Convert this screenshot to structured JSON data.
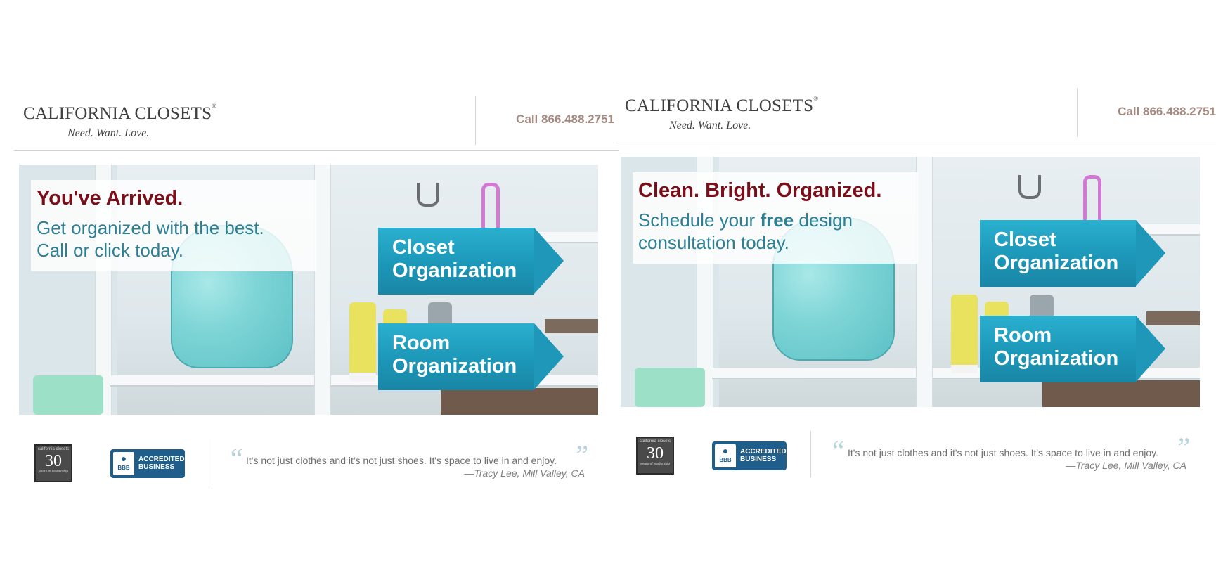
{
  "panels": [
    {
      "brand": {
        "name": "CALIFORNIA CLOSETS",
        "mark": "®",
        "tagline": "Need. Want. Love."
      },
      "phone": "Call 866.488.2751",
      "hero": {
        "headline": "You've Arrived.",
        "subline_parts": [
          "Get organized with the best.",
          "Call or click today."
        ]
      },
      "ctas": [
        {
          "line1": "Closet",
          "line2": "Organization"
        },
        {
          "line1": "Room",
          "line2": "Organization"
        }
      ],
      "footer": {
        "badge30": {
          "top": "california closets",
          "number": "30",
          "bottom": "years of leadership"
        },
        "bbb": {
          "seal": "BBB",
          "line1": "ACCREDITED",
          "line2": "BUSINESS"
        },
        "quote_open": "“",
        "quote_close": "”",
        "quote": "It's not just clothes and it's not just shoes. It's space to live in and enjoy.",
        "attribution": "—Tracy Lee, Mill Valley, CA"
      }
    },
    {
      "brand": {
        "name": "CALIFORNIA CLOSETS",
        "mark": "®",
        "tagline": "Need. Want. Love."
      },
      "phone": "Call 866.488.2751",
      "hero": {
        "headline": "Clean. Bright. Organized.",
        "sub_a": "Schedule your ",
        "sub_bold": "free",
        "sub_b": " design",
        "sub_c": "consultation today."
      },
      "ctas": [
        {
          "line1": "Closet",
          "line2": "Organization"
        },
        {
          "line1": "Room",
          "line2": "Organization"
        }
      ],
      "footer": {
        "badge30": {
          "top": "california closets",
          "number": "30",
          "bottom": "years of leadership"
        },
        "bbb": {
          "seal": "BBB",
          "line1": "ACCREDITED",
          "line2": "BUSINESS"
        },
        "quote_open": "“",
        "quote_close": "”",
        "quote": "It's not just clothes and it's not just shoes. It's space to live in and enjoy.",
        "attribution": "—Tracy Lee, Mill Valley, CA"
      }
    }
  ]
}
